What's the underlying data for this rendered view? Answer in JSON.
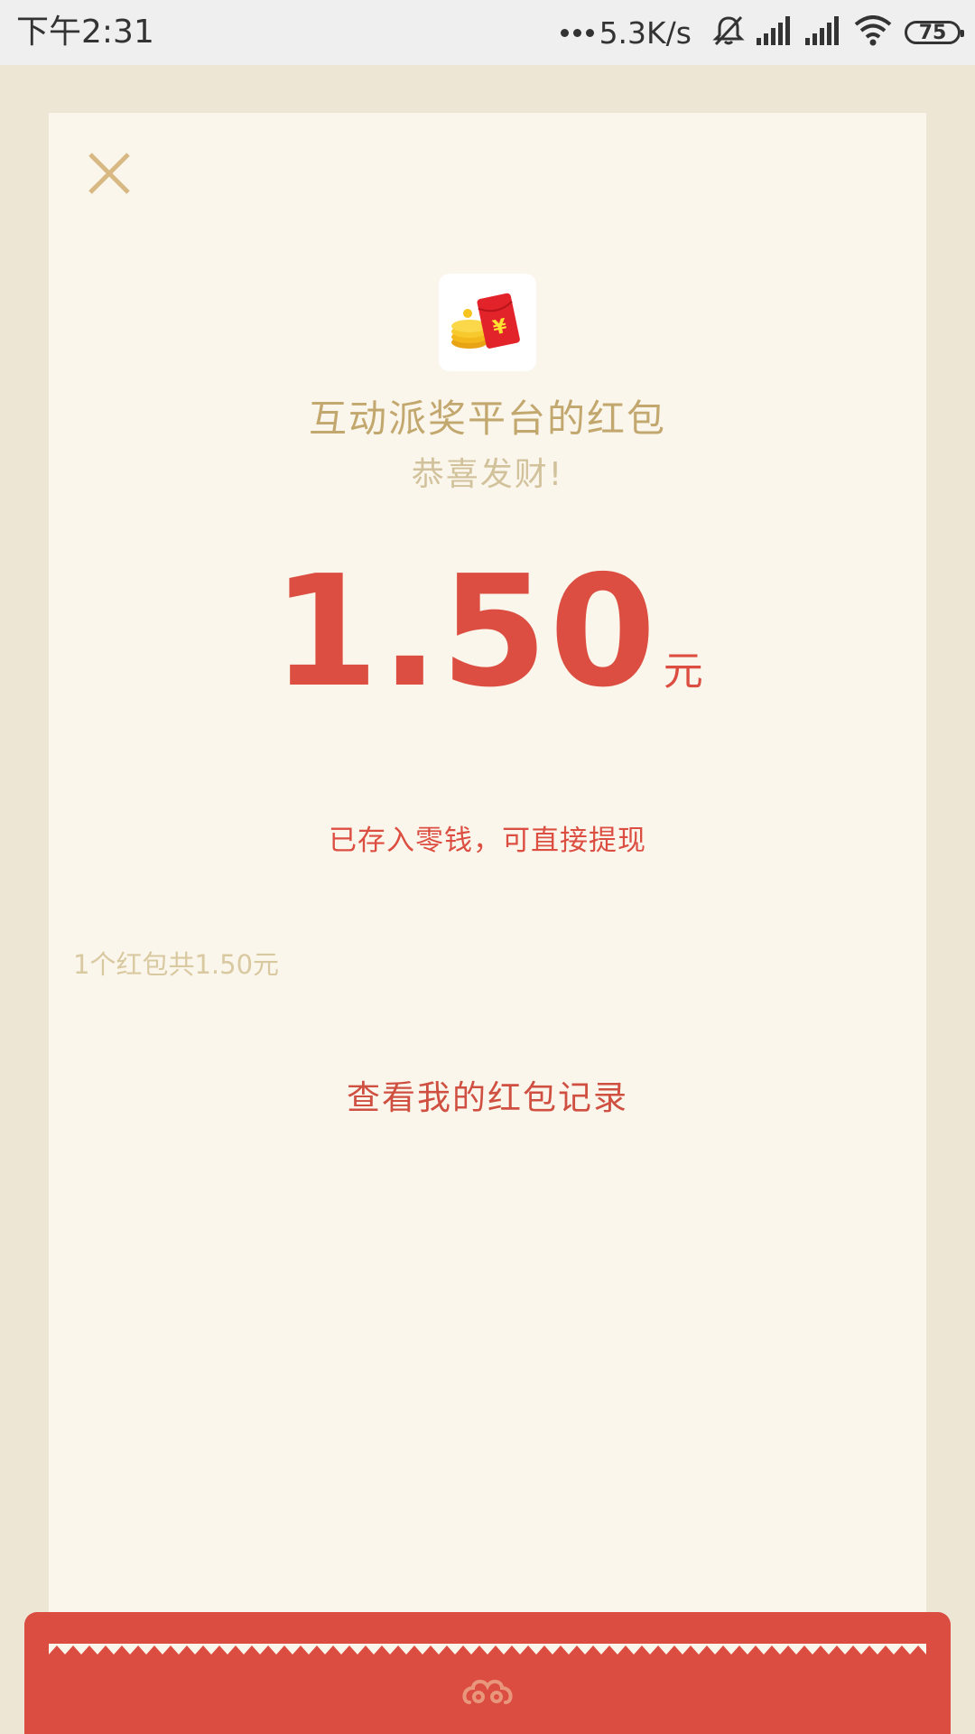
{
  "status_bar": {
    "time": "下午2:31",
    "network_speed": "5.3K/s",
    "battery_level": "75",
    "icons": [
      "muted-bell-icon",
      "signal-icon",
      "signal-icon",
      "wifi-icon",
      "battery-icon"
    ]
  },
  "card": {
    "sender_name": "互动派奖平台的红包",
    "greeting": "恭喜发财!",
    "amount": "1.50",
    "currency_unit": "元",
    "deposit_note": "已存入零钱，可直接提现",
    "summary": "1个红包共1.50元",
    "view_records_label": "查看我的红包记录"
  },
  "colors": {
    "accent_red": "#dc4e41",
    "gold": "#c2a86e",
    "card_bg": "#fbf6ec",
    "page_bg": "#ede6d5"
  }
}
